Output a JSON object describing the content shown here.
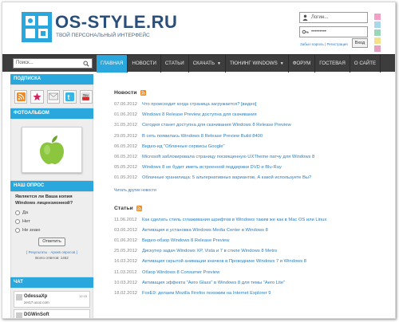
{
  "site": {
    "title": "OS-STYLE.RU",
    "subtitle": "ТВОЙ ПЕРСОНАЛЬНЫЙ ИНТЕРФЕЙС"
  },
  "login": {
    "username_placeholder": "Логин...",
    "password_value": "•••••••••",
    "forgot_link": "Забыл пароль",
    "register_link": "Регистрация",
    "login_button": "Вход"
  },
  "color_swatches": [
    "#f2a0c8",
    "#a8d8ea",
    "#9ad6b8",
    "#f7e08a",
    "#e8a0c0"
  ],
  "search": {
    "placeholder": "Поиск..."
  },
  "nav": [
    {
      "label": "ГЛАВНАЯ",
      "active": true,
      "dropdown": false
    },
    {
      "label": "НОВОСТИ",
      "active": false,
      "dropdown": false
    },
    {
      "label": "СТАТЬИ",
      "active": false,
      "dropdown": false
    },
    {
      "label": "СКАЧАТЬ",
      "active": false,
      "dropdown": true
    },
    {
      "label": "ТЮНИНГ WINDOWS",
      "active": false,
      "dropdown": true
    },
    {
      "label": "ФОРУМ",
      "active": false,
      "dropdown": false
    },
    {
      "label": "ГОСТЕВАЯ",
      "active": false,
      "dropdown": false
    },
    {
      "label": "О САЙТЕ",
      "active": false,
      "dropdown": false
    }
  ],
  "sidebar": {
    "subscribe_title": "ПОДПИСКА",
    "social_icons": [
      "rss-icon",
      "star-icon",
      "mail-icon",
      "twitter-icon",
      "youtube-icon"
    ],
    "photo_title": "ФОТОАЛЬБОМ",
    "poll_title": "НАШ ОПРОС",
    "poll_question": "Является ли Ваша копия Windows лицензионной?",
    "poll_options": [
      "Да",
      "Нет",
      "Не знаю"
    ],
    "vote_button": "Ответить",
    "poll_links": "[ Результаты · Архив опросов ]",
    "poll_total": "Всего ответов: 1452",
    "chat_title": "ЧАТ",
    "chat_messages": [
      {
        "name": "OdessaXp",
        "time": "12:15",
        "text": "zer17.ucoz.com"
      },
      {
        "name": "DGWinSoft",
        "time": "",
        "text": ""
      }
    ]
  },
  "news": {
    "title": "Новости",
    "items": [
      {
        "date": "07.06.2012",
        "title": "Что происходит когда страница загружается? [видео]"
      },
      {
        "date": "01.06.2012",
        "title": "Windows 8 Release Preview доступна для скачивания"
      },
      {
        "date": "31.05.2012",
        "title": "Сегодня станет доступна для скачивания Windows 8 Release Preview"
      },
      {
        "date": "29.05.2012",
        "title": "В сеть появилась Windows 8 Release Preview Build 8400"
      },
      {
        "date": "06.05.2012",
        "title": "Видео-ид \"Облачные сервисы Google\""
      },
      {
        "date": "06.05.2012",
        "title": "Microsoft заблокировала страницу посвященную UXTheme патчу для Windows 8"
      },
      {
        "date": "05.05.2012",
        "title": "Windows 8 не будет иметь встроенной поддержки DVD и Blu-Ray"
      },
      {
        "date": "01.05.2012",
        "title": "Облачные хранилища: 5 альтернативных вариантов, А какой используете Вы?"
      }
    ],
    "more_link": "Читать другие новости"
  },
  "articles": {
    "title": "Статьи",
    "items": [
      {
        "date": "11.06.2012",
        "title": "Как сделать стиль сглаживания шрифтов в Windows таким же как в Mac OS или Linux"
      },
      {
        "date": "03.06.2012",
        "title": "Активация и установка Windows Media Center в Windows 8"
      },
      {
        "date": "01.06.2012",
        "title": "Видео-обзор Windows 8 Release Preview"
      },
      {
        "date": "25.05.2012",
        "title": "Дискутер задач Windows XP, Vista и 7 в стиле Windows 8 Metro"
      },
      {
        "date": "16.03.2012",
        "title": "Активация скрытой анимации значков в Проводнике Windows 7 и Windows 8"
      },
      {
        "date": "11.03.2012",
        "title": "Обзор Windows 8 Consumer Preview"
      },
      {
        "date": "10.03.2012",
        "title": "Активация эффекта \"Aero Glass\" в Windows 8 для темы \"Aero Lite\""
      },
      {
        "date": "18.02.2012",
        "title": "FoxE9: делаем Mozilla Firefox похожим на Internet Explorer 9"
      }
    ]
  }
}
